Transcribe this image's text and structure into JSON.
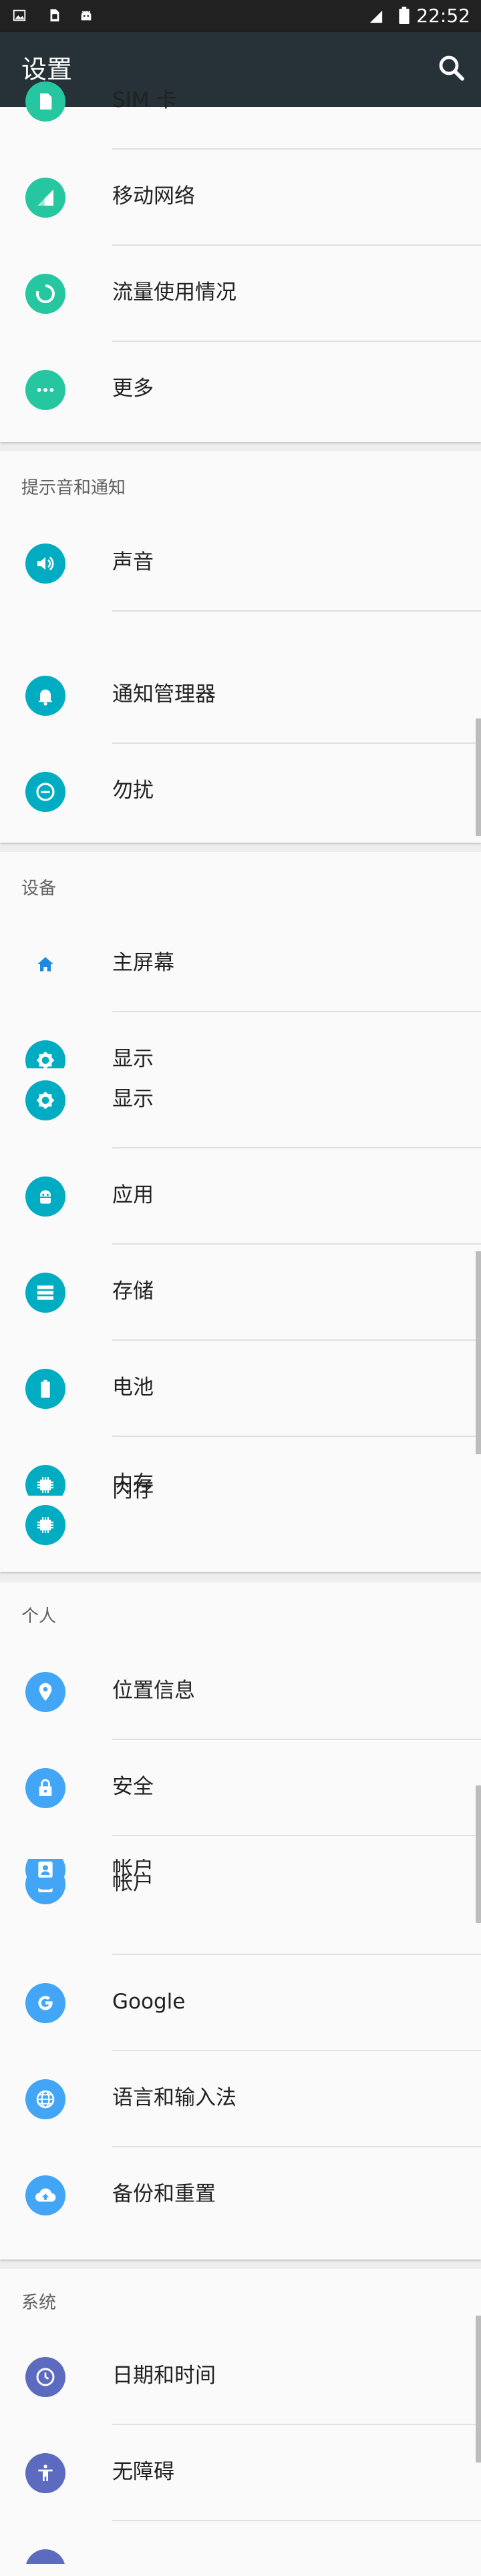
{
  "status_bar": {
    "time": "22:52",
    "icons": [
      "image-icon",
      "sim-icon",
      "android-icon",
      "signal-icon",
      "battery-icon"
    ]
  },
  "app_bar": {
    "title": "设置",
    "search_icon": "search-icon"
  },
  "sections": {
    "wireless": {
      "items": [
        {
          "label": "SIM 卡",
          "icon": "sim-card-icon",
          "color": "#26c6a0"
        },
        {
          "label": "移动网络",
          "icon": "signal-icon",
          "color": "#26c6a0"
        },
        {
          "label": "流量使用情况",
          "icon": "data-usage-icon",
          "color": "#26c6a0"
        },
        {
          "label": "更多",
          "icon": "more-icon",
          "color": "#26c6a0"
        }
      ]
    },
    "notifications": {
      "header": "提示音和通知",
      "items": [
        {
          "label": "声音",
          "icon": "volume-icon",
          "color": "#00acc1"
        },
        {
          "label": "通知管理器",
          "icon": "bell-icon",
          "color": "#00acc1"
        },
        {
          "label": "勿扰",
          "icon": "do-not-disturb-icon",
          "color": "#00acc1"
        }
      ]
    },
    "device": {
      "header": "设备",
      "items": [
        {
          "label": "主屏幕",
          "icon": "home-icon",
          "color": "#1e88e5"
        },
        {
          "label": "显示",
          "icon": "brightness-icon",
          "color": "#00acc1"
        },
        {
          "label": "显示",
          "icon": "brightness-icon",
          "color": "#00acc1"
        },
        {
          "label": "应用",
          "icon": "android-icon",
          "color": "#00acc1"
        },
        {
          "label": "存储",
          "icon": "storage-icon",
          "color": "#00acc1"
        },
        {
          "label": "电池",
          "icon": "battery-icon",
          "color": "#00acc1"
        },
        {
          "label": "内存",
          "icon": "memory-icon",
          "color": "#00acc1"
        },
        {
          "label": "内存",
          "icon": "memory-icon",
          "color": "#00acc1"
        }
      ]
    },
    "personal": {
      "header": "个人",
      "items": [
        {
          "label": "位置信息",
          "icon": "location-icon",
          "color": "#42a5f5"
        },
        {
          "label": "安全",
          "icon": "lock-icon",
          "color": "#42a5f5"
        },
        {
          "label": "帐户",
          "icon": "account-icon",
          "color": "#42a5f5"
        },
        {
          "label": "帐户",
          "icon": "account-icon",
          "color": "#42a5f5"
        },
        {
          "label": "Google",
          "icon": "google-icon",
          "color": "#42a5f5"
        },
        {
          "label": "语言和输入法",
          "icon": "globe-icon",
          "color": "#42a5f5"
        },
        {
          "label": "备份和重置",
          "icon": "cloud-upload-icon",
          "color": "#42a5f5"
        }
      ]
    },
    "system": {
      "header": "系统",
      "items": [
        {
          "label": "日期和时间",
          "icon": "clock-icon",
          "color": "#5c6bc0"
        },
        {
          "label": "无障碍",
          "icon": "accessibility-icon",
          "color": "#5c6bc0"
        }
      ]
    }
  }
}
